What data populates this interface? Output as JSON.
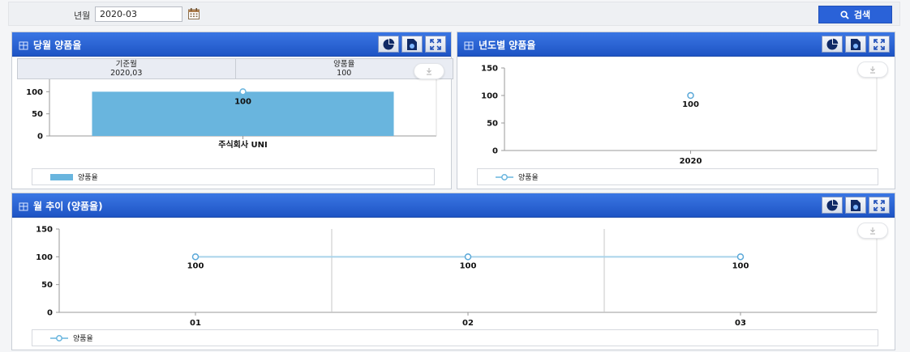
{
  "search": {
    "label": "년월",
    "value": "2020-03",
    "button_label": "검색"
  },
  "colors": {
    "header_blue": "#2a62d8",
    "bar": "#69b5de",
    "line": "#a9d3ea"
  },
  "panels": {
    "monthly": {
      "title": "당월 양품율",
      "info": {
        "col1_header": "기준월",
        "col1_value": "2020,03",
        "col2_header": "양품율",
        "col2_value": "100"
      },
      "legend": "양품율"
    },
    "yearly": {
      "title": "년도별 양품율",
      "legend": "양품율"
    },
    "trend": {
      "title": "월 추이 (양품율)",
      "legend": "양품율"
    }
  },
  "chart_data": [
    {
      "type": "bar",
      "categories": [
        "주식회사 UNI"
      ],
      "series": [
        {
          "name": "양품율",
          "values": [
            100
          ]
        }
      ],
      "ylim": [
        0,
        150
      ],
      "yticks": [
        0,
        50,
        100,
        150
      ],
      "data_labels": [
        "100"
      ],
      "legend": "bottom"
    },
    {
      "type": "line",
      "categories": [
        "2020"
      ],
      "series": [
        {
          "name": "양품율",
          "values": [
            100
          ]
        }
      ],
      "ylim": [
        0,
        150
      ],
      "yticks": [
        0,
        50,
        100,
        150
      ],
      "data_labels": [
        "100"
      ],
      "legend": "bottom"
    },
    {
      "type": "line",
      "categories": [
        "01",
        "02",
        "03"
      ],
      "series": [
        {
          "name": "양품율",
          "values": [
            100,
            100,
            100
          ]
        }
      ],
      "ylim": [
        0,
        150
      ],
      "yticks": [
        0,
        50,
        100,
        150
      ],
      "data_labels": [
        "100",
        "100",
        "100"
      ],
      "legend": "bottom"
    }
  ]
}
